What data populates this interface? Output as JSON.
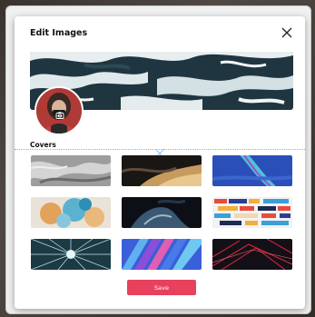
{
  "modal": {
    "title": "Edit Images",
    "close_icon": "close-icon"
  },
  "banner": {
    "image": "ocean-waves-aerial"
  },
  "avatar": {
    "image": "profile-photo",
    "overlay_icon": "camera-icon"
  },
  "covers": {
    "label": "Covers",
    "items": [
      {
        "name": "cover-gray-marble"
      },
      {
        "name": "cover-dark-smoke-gold"
      },
      {
        "name": "cover-blue-ribbon"
      },
      {
        "name": "cover-blue-orange-smoke"
      },
      {
        "name": "cover-dark-blue-ink"
      },
      {
        "name": "cover-colorful-blocks"
      },
      {
        "name": "cover-light-tunnel"
      },
      {
        "name": "cover-blue-pink-stairs"
      },
      {
        "name": "cover-red-lines-dark"
      }
    ]
  },
  "actions": {
    "save_label": "Save"
  },
  "colors": {
    "accent": "#e8415e",
    "guide": "#7fb3e6"
  }
}
